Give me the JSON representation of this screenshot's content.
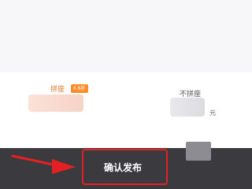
{
  "options": {
    "group": {
      "label": "拼座",
      "badge": "6.6折"
    },
    "solo": {
      "label": "不拼座",
      "price_suffix": "元"
    }
  },
  "bottom_bar": {
    "confirm_label": "确认发布"
  },
  "colors": {
    "accent_orange": "#ff8c28",
    "highlight_red": "#e32124",
    "bar_dark": "#3b3b3f"
  },
  "icons": [
    "arrow-right-icon"
  ]
}
